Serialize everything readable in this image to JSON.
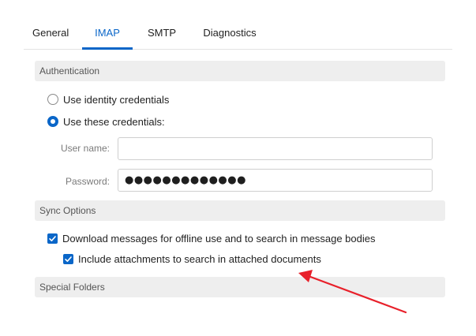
{
  "tabs": [
    {
      "id": "general",
      "label": "General"
    },
    {
      "id": "imap",
      "label": "IMAP"
    },
    {
      "id": "smtp",
      "label": "SMTP"
    },
    {
      "id": "diagnostics",
      "label": "Diagnostics"
    }
  ],
  "active_tab": "IMAP",
  "authentication": {
    "title": "Authentication",
    "option_identity": "Use identity credentials",
    "option_these": "Use these credentials:",
    "selected_option": "Use these credentials:",
    "username_label": "User name:",
    "username_value": "",
    "password_label": "Password:",
    "password_value": "●●●●●●●●●●●●●"
  },
  "sync": {
    "title": "Sync Options",
    "download_label": "Download messages for offline use and to search in message bodies",
    "download_checked": true,
    "include_label": "Include attachments to search in attached documents",
    "include_checked": true
  },
  "special_folders": {
    "title": "Special Folders"
  },
  "colors": {
    "accent": "#0a66c8",
    "annotation": "#e8202a"
  },
  "icons": {
    "check": "check-icon",
    "arrow": "annotation-arrow-icon"
  }
}
